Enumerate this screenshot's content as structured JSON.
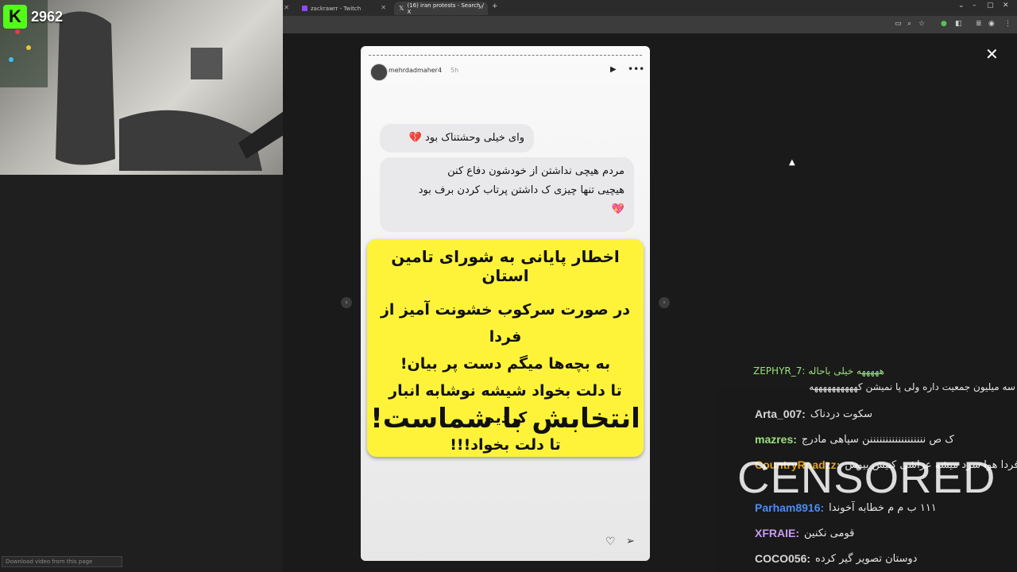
{
  "kick": {
    "viewer_count": "2962",
    "logo_letter": "K"
  },
  "browser": {
    "tabs": [
      {
        "label": "zackrawrr - Twitch"
      },
      {
        "label": "(16) iran protests - Search / X"
      }
    ],
    "new_tab": "+",
    "window_min": "–",
    "window_max": "▢",
    "window_close": "✕"
  },
  "story": {
    "username": "mehrdadmaher4",
    "time": "5h",
    "bubble1": "وای خیلی وحشتناک بود 💔",
    "bubble2_lines": [
      "مردم هیچی نداشتن از خودشون دفاع کنن",
      "هیچیی تنها چیزی ک داشتن پرتاب کردن برف بود",
      "💖"
    ],
    "card": {
      "line1": "اخطار پایانی به شورای تامین استان",
      "line2": "در صورت سرکوب خشونت آمیز از فردا",
      "line3": "به بچه‌ها میگم دست پر بیان!",
      "line4": "تا دلت بخواد شیشه نوشابه انبار کردیم",
      "line5": "تا دلت بخواد!!!",
      "line6": "انتخابش با شماست!"
    }
  },
  "chat": {
    "overflow_line": "ZEPHYR_7: هههههه خیلی باحاله",
    "top_message": "سه میلیون جمعیت داره ولی پا نمیشن کههههههههههه",
    "messages": [
      {
        "name": "Arta_007:",
        "text": "سکوت دردناک",
        "color": "#d8d8d8"
      },
      {
        "name": "mazres:",
        "text": "ک ص ننننننننننننننننننن سپاهی مادرج",
        "color": "#9be07b"
      },
      {
        "name": "CountryRoadzz:",
        "text": "فردا هوا سرد میشه عزاشی کنیش بیوش",
        "color": "#e0a11b"
      },
      {
        "name": "Parham8916:",
        "text": "۱۱۱ ب م م خطابه آخوندا",
        "color": "#4a8df0"
      },
      {
        "name": "XFRAIE:",
        "text": "قومی نکنین",
        "color": "#c79bf2"
      },
      {
        "name": "COCO056:",
        "text": "دوستان تصویر گیر کرده",
        "color": "#d8d8d8"
      }
    ],
    "censored_text": "CENSORED"
  },
  "download_bar": "Download video from this page"
}
